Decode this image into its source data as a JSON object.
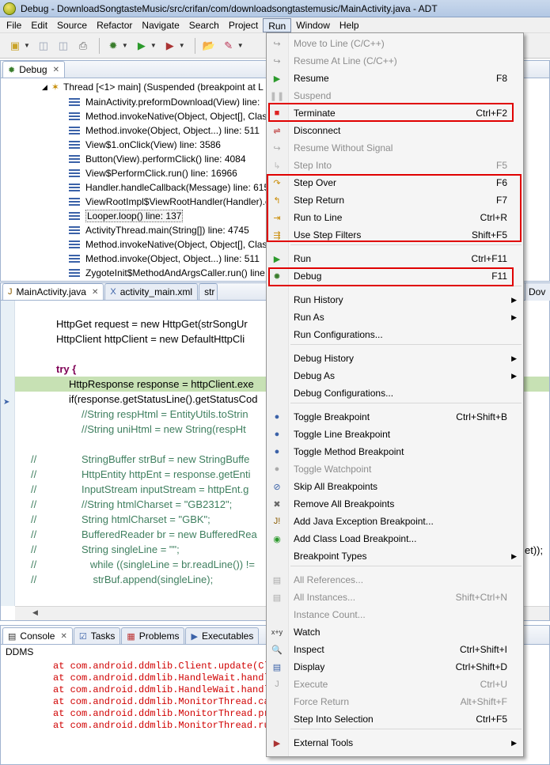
{
  "window": {
    "title": "Debug - DownloadSongtasteMusic/src/crifan/com/downloadsongtastemusic/MainActivity.java - ADT"
  },
  "menubar": [
    "File",
    "Edit",
    "Source",
    "Refactor",
    "Navigate",
    "Search",
    "Project",
    "Run",
    "Window",
    "Help"
  ],
  "debug_view": {
    "tab": "Debug",
    "thread": "Thread [<1> main] (Suspended (breakpoint at L",
    "frames": [
      "MainActivity.preformDownload(View) line:",
      "Method.invokeNative(Object, Object[], Clas",
      "Method.invoke(Object, Object...) line: 511",
      "View$1.onClick(View) line: 3586",
      "Button(View).performClick() line: 4084",
      "View$PerformClick.run() line: 16966",
      "Handler.handleCallback(Message) line: 615",
      "ViewRootImpl$ViewRootHandler(Handler).c",
      "Looper.loop() line: 137",
      "ActivityThread.main(String[]) line: 4745",
      "Method.invokeNative(Object, Object[], Clas",
      "Method.invoke(Object, Object...) line: 511",
      "ZygoteInit$MethodAndArgsCaller.run() line"
    ]
  },
  "editor": {
    "tabs": [
      "MainActivity.java",
      "activity_main.xml",
      "str"
    ],
    "right_tab": "Dov",
    "line1": "HttpGet request = new HttpGet(strSongUr",
    "line2": "HttpClient httpClient = new DefaultHttpCli",
    "try": "try {",
    "highlight": "HttpResponse response = httpClient.exe",
    "ifline": "if(response.getStatusLine().getStatusCod",
    "c1": "//String respHtml = EntityUtils.toStrin",
    "c2": "//String uniHtml = new String(respHt",
    "comments": [
      {
        "g": "//",
        "t": "StringBuffer strBuf = new StringBuffe"
      },
      {
        "g": "//",
        "t": "HttpEntity httpEnt = response.getEnti"
      },
      {
        "g": "//",
        "t": "InputStream inputStream = httpEnt.g"
      },
      {
        "g": "//",
        "t": "//String htmlCharset = \"GB2312\";"
      },
      {
        "g": "//",
        "t": "String htmlCharset = \"GBK\";"
      },
      {
        "g": "//",
        "t": "BufferedReader br = new BufferedRea"
      },
      {
        "g": "//",
        "t": "String singleLine = \"\";"
      },
      {
        "g": "//",
        "t": "   while ((singleLine = br.readLine()) !="
      },
      {
        "g": "//",
        "t": "    strBuf.append(singleLine);"
      }
    ],
    "overflow_tail": "et));"
  },
  "console": {
    "tabs": [
      "Console",
      "Tasks",
      "Problems",
      "Executables"
    ],
    "header": "DDMS",
    "lines": [
      "at com.android.ddmlib.Client.update(Cli",
      "at com.android.ddmlib.HandleWait.handle",
      "at com.android.ddmlib.HandleWait.handle",
      "at com.android.ddmlib.MonitorThread.cal",
      "at com.android.ddmlib.MonitorThread.pro",
      "at com.android.ddmlib.MonitorThread.run"
    ]
  },
  "run_menu": {
    "items": [
      {
        "label": "Move to Line (C/C++)",
        "shortcut": "",
        "disabled": true,
        "icon": "move-to-line-icon"
      },
      {
        "label": "Resume At Line (C/C++)",
        "shortcut": "",
        "disabled": true,
        "icon": "resume-at-line-icon"
      },
      {
        "label": "Resume",
        "shortcut": "F8",
        "disabled": false,
        "icon": "resume-icon"
      },
      {
        "label": "Suspend",
        "shortcut": "",
        "disabled": true,
        "icon": "suspend-icon"
      },
      {
        "label": "Terminate",
        "shortcut": "Ctrl+F2",
        "disabled": false,
        "icon": "terminate-icon"
      },
      {
        "label": "Disconnect",
        "shortcut": "",
        "disabled": false,
        "icon": "disconnect-icon"
      },
      {
        "label": "Resume Without Signal",
        "shortcut": "",
        "disabled": true,
        "icon": "resume-without-signal-icon"
      },
      {
        "label": "Step Into",
        "shortcut": "F5",
        "disabled": true,
        "icon": "step-into-icon"
      },
      {
        "label": "Step Over",
        "shortcut": "F6",
        "disabled": false,
        "icon": "step-over-icon"
      },
      {
        "label": "Step Return",
        "shortcut": "F7",
        "disabled": false,
        "icon": "step-return-icon"
      },
      {
        "label": "Run to Line",
        "shortcut": "Ctrl+R",
        "disabled": false,
        "icon": "run-to-line-icon"
      },
      {
        "label": "Use Step Filters",
        "shortcut": "Shift+F5",
        "disabled": false,
        "icon": "step-filters-icon"
      },
      {
        "label": "Run",
        "shortcut": "Ctrl+F11",
        "disabled": false,
        "icon": "run-icon"
      },
      {
        "label": "Debug",
        "shortcut": "F11",
        "disabled": false,
        "icon": "debug-icon"
      },
      {
        "label": "Run History",
        "shortcut": "",
        "disabled": false,
        "icon": ""
      },
      {
        "label": "Run As",
        "shortcut": "",
        "disabled": false,
        "icon": ""
      },
      {
        "label": "Run Configurations...",
        "shortcut": "",
        "disabled": false,
        "icon": ""
      },
      {
        "label": "Debug History",
        "shortcut": "",
        "disabled": false,
        "icon": ""
      },
      {
        "label": "Debug As",
        "shortcut": "",
        "disabled": false,
        "icon": ""
      },
      {
        "label": "Debug Configurations...",
        "shortcut": "",
        "disabled": false,
        "icon": ""
      },
      {
        "label": "Toggle Breakpoint",
        "shortcut": "Ctrl+Shift+B",
        "disabled": false,
        "icon": "breakpoint-icon"
      },
      {
        "label": "Toggle Line Breakpoint",
        "shortcut": "",
        "disabled": false,
        "icon": "breakpoint-icon"
      },
      {
        "label": "Toggle Method Breakpoint",
        "shortcut": "",
        "disabled": false,
        "icon": "breakpoint-icon"
      },
      {
        "label": "Toggle Watchpoint",
        "shortcut": "",
        "disabled": true,
        "icon": "watchpoint-icon"
      },
      {
        "label": "Skip All Breakpoints",
        "shortcut": "",
        "disabled": false,
        "icon": "skip-breakpoints-icon"
      },
      {
        "label": "Remove All Breakpoints",
        "shortcut": "",
        "disabled": false,
        "icon": "remove-breakpoints-icon"
      },
      {
        "label": "Add Java Exception Breakpoint...",
        "shortcut": "",
        "disabled": false,
        "icon": "exception-breakpoint-icon"
      },
      {
        "label": "Add Class Load Breakpoint...",
        "shortcut": "",
        "disabled": false,
        "icon": "class-load-icon"
      },
      {
        "label": "Breakpoint Types",
        "shortcut": "",
        "disabled": false,
        "icon": ""
      },
      {
        "label": "All References...",
        "shortcut": "",
        "disabled": true,
        "icon": "references-icon"
      },
      {
        "label": "All Instances...",
        "shortcut": "Shift+Ctrl+N",
        "disabled": true,
        "icon": "instances-icon"
      },
      {
        "label": "Instance Count...",
        "shortcut": "",
        "disabled": true,
        "icon": ""
      },
      {
        "label": "Watch",
        "shortcut": "",
        "disabled": false,
        "icon": "watch-icon"
      },
      {
        "label": "Inspect",
        "shortcut": "Ctrl+Shift+I",
        "disabled": false,
        "icon": "inspect-icon"
      },
      {
        "label": "Display",
        "shortcut": "Ctrl+Shift+D",
        "disabled": false,
        "icon": "display-icon"
      },
      {
        "label": "Execute",
        "shortcut": "Ctrl+U",
        "disabled": true,
        "icon": "execute-icon"
      },
      {
        "label": "Force Return",
        "shortcut": "Alt+Shift+F",
        "disabled": true,
        "icon": ""
      },
      {
        "label": "Step Into Selection",
        "shortcut": "Ctrl+F5",
        "disabled": false,
        "icon": ""
      },
      {
        "label": "External Tools",
        "shortcut": "",
        "disabled": false,
        "icon": "external-tools-icon"
      }
    ]
  },
  "colors": {
    "highlight_box": "#e00000",
    "code_highlight": "#c7e1b4",
    "keyword": "#7f0055",
    "comment": "#3f7f5f",
    "console_error": "#d00000"
  }
}
